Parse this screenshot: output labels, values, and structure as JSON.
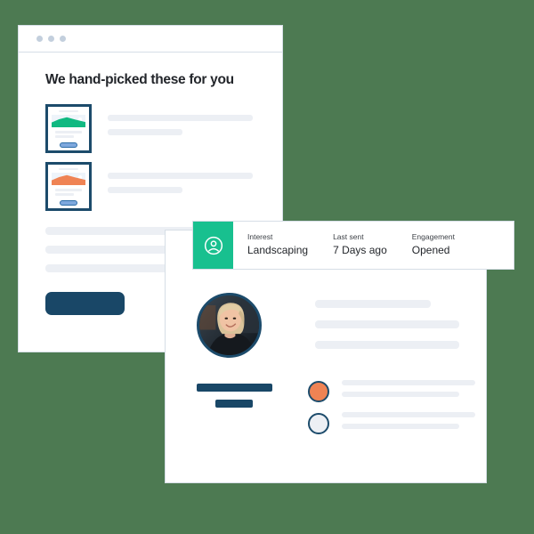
{
  "background_color": "#4d7a52",
  "window_recommendations": {
    "name": "recommendations-window",
    "titlebar": {
      "dots": [
        "window-dot",
        "window-dot",
        "window-dot"
      ],
      "dot_color": "#c3cfdd"
    },
    "headline": "We hand-picked these for you",
    "thumbnails": [
      {
        "id": "thumbnail-card-1",
        "accent_color": "#10b981",
        "button_color": "#7ea8dd",
        "border_color": "#1c4b6b"
      },
      {
        "id": "thumbnail-card-2",
        "accent_color": "#ef8354",
        "button_color": "#7ea8dd",
        "border_color": "#1c4b6b"
      }
    ],
    "paragraph_placeholders": 3,
    "cta_button": {
      "label": "",
      "color": "#194767"
    }
  },
  "window_contact": {
    "name": "contact-detail-window",
    "infobar": {
      "icon": "user-profile-icon",
      "icon_background": "#18c08f",
      "columns": [
        {
          "label": "Interest",
          "value": "Landscaping"
        },
        {
          "label": "Last sent",
          "value": "7 Days ago"
        },
        {
          "label": "Engagement",
          "value": "Opened"
        }
      ]
    },
    "avatar": {
      "name": "contact-avatar",
      "border_color": "#1c4b6b",
      "description": "photo of smiling person"
    },
    "detail_placeholders": 3,
    "name_bars": 2,
    "name_bar_color": "#194767",
    "options": [
      {
        "id": "option-selected",
        "circle_color": "#ef8354",
        "border_color": "#1c4b6b",
        "lines": 2
      },
      {
        "id": "option-unselected",
        "circle_color": "#eceff4",
        "border_color": "#1c4b6b",
        "lines": 2
      }
    ]
  }
}
